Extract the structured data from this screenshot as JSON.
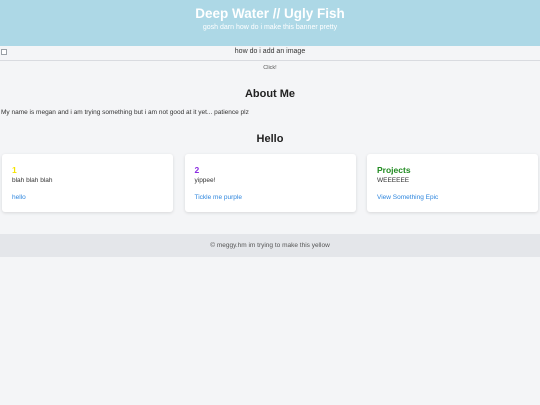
{
  "banner": {
    "title": "Deep Water // Ugly Fish",
    "subtitle": "gosh darn how do i make this banner pretty"
  },
  "image": {
    "alt_text": "how do i add an image",
    "click_label": "Click!"
  },
  "about": {
    "title": "About Me",
    "text": "My name is megan and i am trying something but i am not good at it yet... patience plz"
  },
  "hello": {
    "title": "Hello",
    "cards": [
      {
        "heading": "1",
        "heading_color": "#f5e400",
        "text": "blah blah blah",
        "link": "hello"
      },
      {
        "heading": "2",
        "heading_color": "#8a2be2",
        "text": "yippee!",
        "link": "Tickle me purple"
      },
      {
        "heading": "Projects",
        "heading_color": "#1f8a1f",
        "text": "WEEEEEE",
        "link": "View Something Epic"
      }
    ]
  },
  "footer": {
    "text": "© meggy.hm im trying to make this yellow"
  },
  "colors": {
    "banner_bg": "#add8e6",
    "link": "#2e86de",
    "page_bg": "#f4f5f7"
  }
}
